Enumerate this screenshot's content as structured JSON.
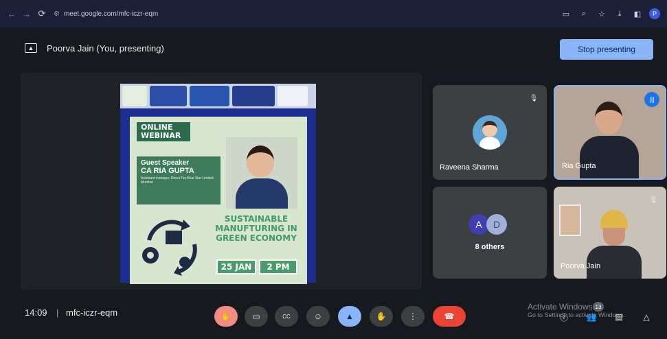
{
  "browser": {
    "url": "meet.google.com/mfc-iczr-eqm",
    "profile_initial": "P"
  },
  "meet": {
    "presenting_banner": "Poorva Jain (You, presenting)",
    "stop_presenting_label": "Stop presenting",
    "slide": {
      "webinar_tag": "ONLINE WEBINAR",
      "speaker_title": "Guest Speaker",
      "speaker_name": "CA RIA GUPTA",
      "speaker_desc": "Assistant manager, Direct Tax Blue Star Limited, Mumbai",
      "topic": "SUSTAINABLE MANUFTURING IN GREEN ECONOMY",
      "date": "25 JAN",
      "time": "2 PM"
    },
    "participants": [
      {
        "name": "Raveena Sharma",
        "muted": true
      },
      {
        "name": "Ria Gupta",
        "speaking": true
      },
      {
        "name": "8 others",
        "avatars": [
          "A",
          "D"
        ]
      },
      {
        "name": "Poorva Jain",
        "muted": true
      }
    ],
    "time": "14:09",
    "meeting_code": "mfc-iczr-eqm",
    "people_count": "13",
    "watermark": {
      "title": "Activate Windows",
      "subtitle": "Go to Settings to activate Windows."
    }
  }
}
